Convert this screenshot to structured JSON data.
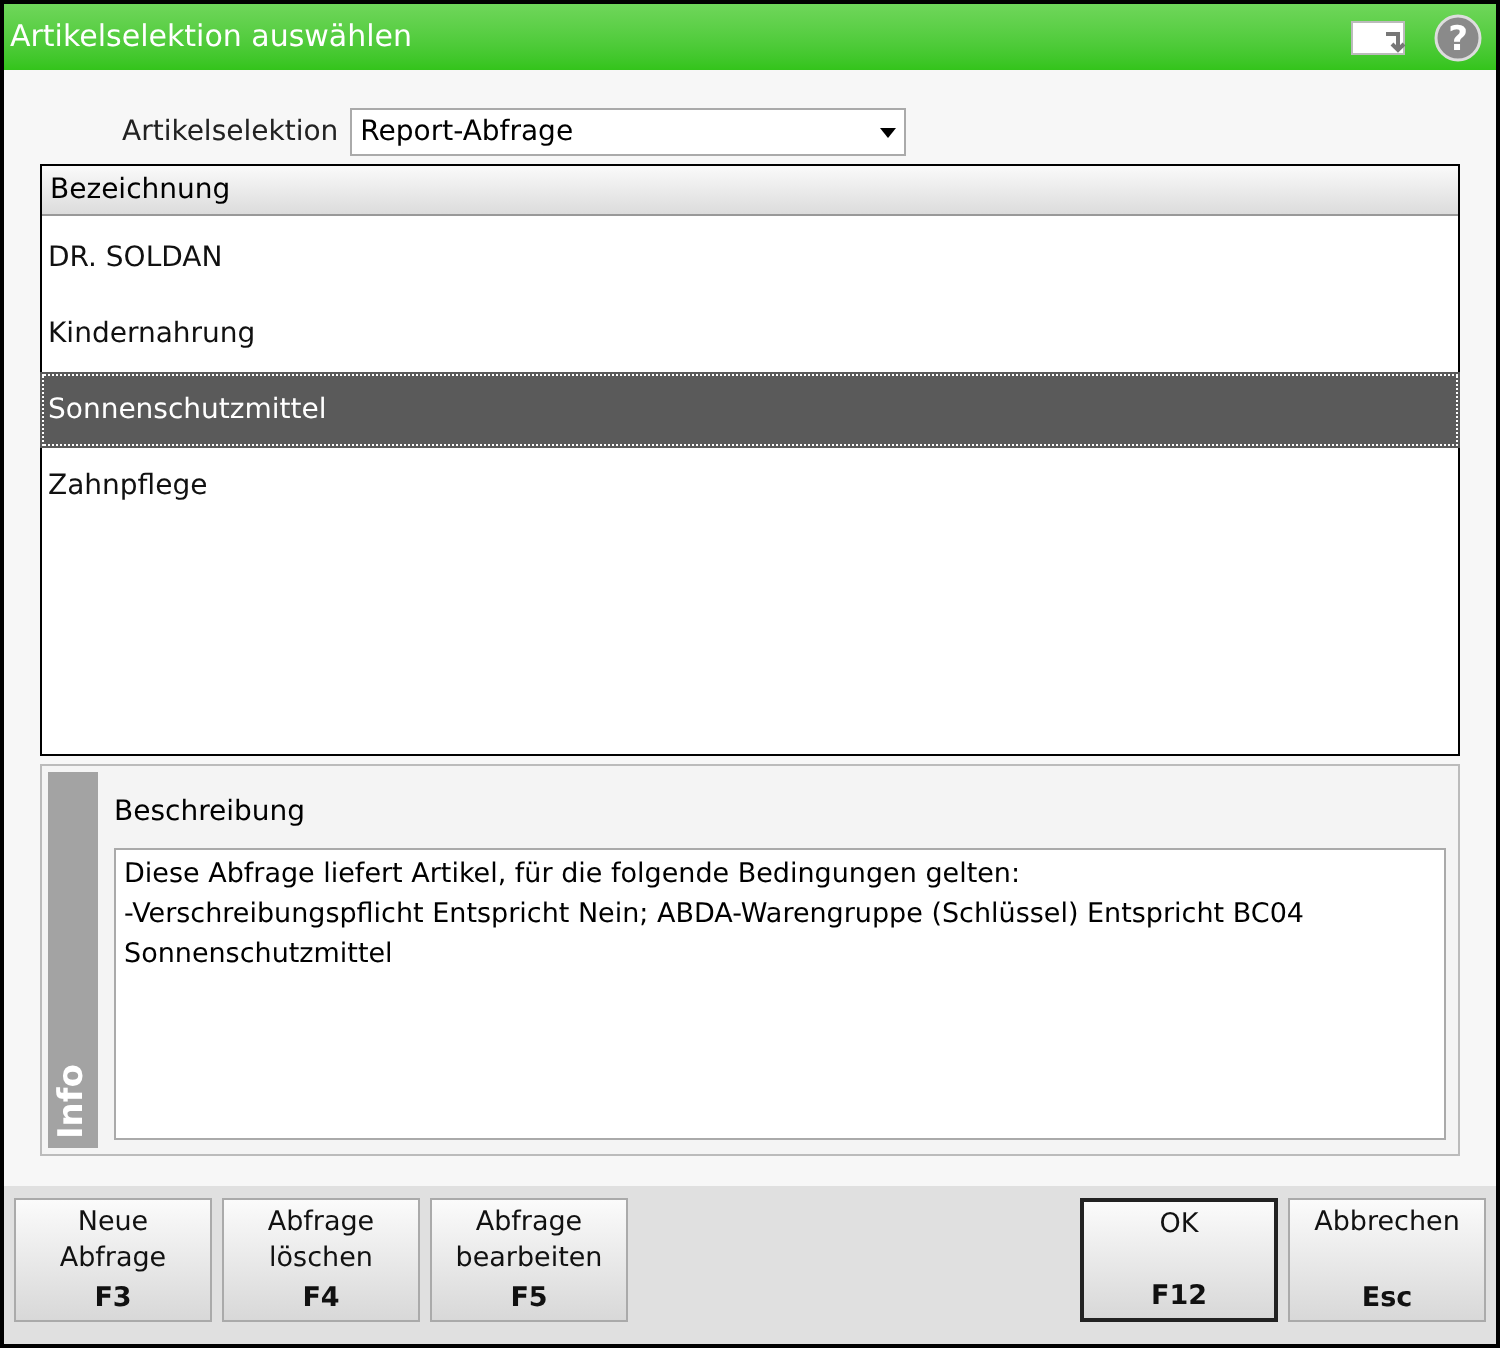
{
  "window": {
    "title": "Artikelselektion auswählen",
    "help": "?"
  },
  "selection": {
    "label": "Artikelselektion",
    "value": "Report-Abfrage"
  },
  "table": {
    "columns": [
      "Bezeichnung"
    ],
    "rows": [
      {
        "name": "DR. SOLDAN",
        "selected": false
      },
      {
        "name": "Kindernahrung",
        "selected": false
      },
      {
        "name": "Sonnenschutzmittel",
        "selected": true
      },
      {
        "name": "Zahnpflege",
        "selected": false
      }
    ]
  },
  "info": {
    "tab": "Info",
    "heading": "Beschreibung",
    "text": "Diese Abfrage liefert Artikel, für die folgende Bedingungen gelten:\n-Verschreibungspflicht Entspricht Nein; ABDA-Warengruppe (Schlüssel) Entspricht BC04 Sonnenschutzmittel"
  },
  "buttons_left": [
    {
      "label": "Neue\nAbfrage",
      "key": "F3",
      "default": false
    },
    {
      "label": "Abfrage\nlöschen",
      "key": "F4",
      "default": false
    },
    {
      "label": "Abfrage\nbearbeiten",
      "key": "F5",
      "default": false
    }
  ],
  "buttons_right": [
    {
      "label": "OK",
      "key": "F12",
      "default": true
    },
    {
      "label": "Abbrechen",
      "key": "Esc",
      "default": false
    }
  ]
}
